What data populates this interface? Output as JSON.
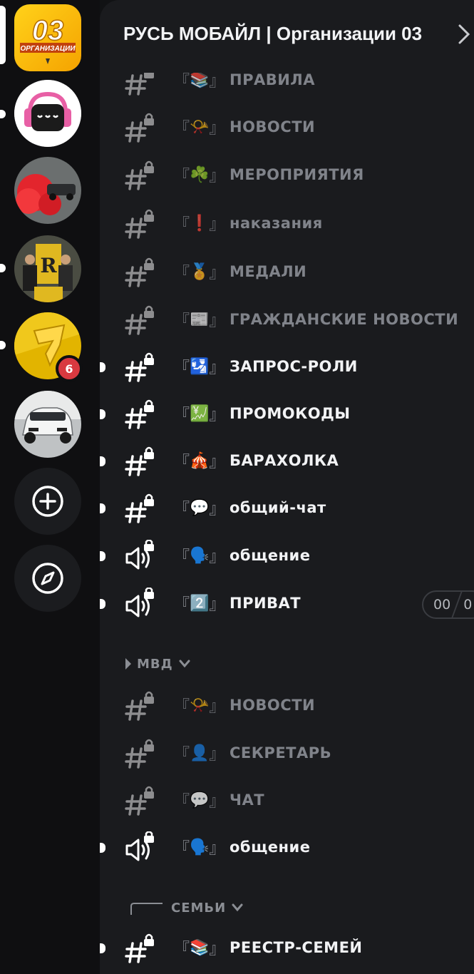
{
  "header": {
    "title": "РУСЬ МОБАЙЛ | Организации 03"
  },
  "servers": [
    {
      "name": "Организации 03",
      "logo_text_big": "03",
      "logo_text_small": "ОРГАНИЗАЦИИ",
      "active": true
    },
    {
      "name": "headphones-mascot",
      "unread": true
    },
    {
      "name": "red-smoke-car"
    },
    {
      "name": "group-photo",
      "unread": true
    },
    {
      "name": "yellow-logo",
      "unread": true,
      "badge": "6"
    },
    {
      "name": "white-car"
    }
  ],
  "rail_actions": {
    "add_server_icon": "plus-circle-icon",
    "explore_icon": "compass-icon"
  },
  "channels_top": [
    {
      "emoji": "📚",
      "name": "ПРАВИЛА",
      "type": "text",
      "state": "muted"
    },
    {
      "emoji": "📯",
      "name": "НОВОСТИ",
      "type": "text",
      "state": "muted"
    },
    {
      "emoji": "☘️",
      "name": "МЕРОПРИЯТИЯ",
      "type": "text",
      "state": "muted"
    },
    {
      "emoji": "❗",
      "name": "наказания",
      "type": "text",
      "state": "muted"
    },
    {
      "emoji": "🏅",
      "name": "МЕДАЛИ",
      "type": "text",
      "state": "muted"
    },
    {
      "emoji": "📰",
      "name": "ГРАЖДАНСКИЕ НОВОСТИ",
      "type": "text",
      "state": "muted"
    },
    {
      "emoji": "🛂",
      "name": "ЗАПРОС-РОЛИ",
      "type": "text",
      "state": "unread"
    },
    {
      "emoji": "💹",
      "name": "ПРОМОКОДЫ",
      "type": "text",
      "state": "unread"
    },
    {
      "emoji": "🎪",
      "name": "БАРАХОЛКА",
      "type": "text",
      "state": "unread"
    },
    {
      "emoji": "💬",
      "name": "общий-чат",
      "type": "text",
      "state": "unread"
    },
    {
      "emoji": "🗣️",
      "name": "общение",
      "type": "voice",
      "state": "unread"
    },
    {
      "emoji": "2️⃣",
      "name": "ПРИВАТ",
      "type": "voice",
      "state": "unread",
      "user_count": "00",
      "user_limit": "0"
    }
  ],
  "category_mvd": {
    "label": "МВД"
  },
  "channels_mvd": [
    {
      "emoji": "📯",
      "name": "НОВОСТИ",
      "type": "text",
      "state": "muted"
    },
    {
      "emoji": "👤",
      "name": "СЕКРЕТАРЬ",
      "type": "text",
      "state": "muted"
    },
    {
      "emoji": "💬",
      "name": "ЧАТ",
      "type": "text",
      "state": "muted"
    },
    {
      "emoji": "🗣️",
      "name": "общение",
      "type": "voice",
      "state": "unread"
    }
  ],
  "category_families": {
    "label": "СЕМЬИ"
  },
  "channels_families": [
    {
      "emoji": "📚",
      "name": "РЕЕСТР-СЕМЕЙ",
      "type": "text",
      "state": "unread"
    }
  ],
  "bracket_open": "『",
  "bracket_close": "』",
  "colors": {
    "rail": "#0f0f11",
    "panel": "#1a1b1e",
    "muted_text": "#80838a",
    "bright_text": "#f2f3f5",
    "badge": "#d93940"
  }
}
